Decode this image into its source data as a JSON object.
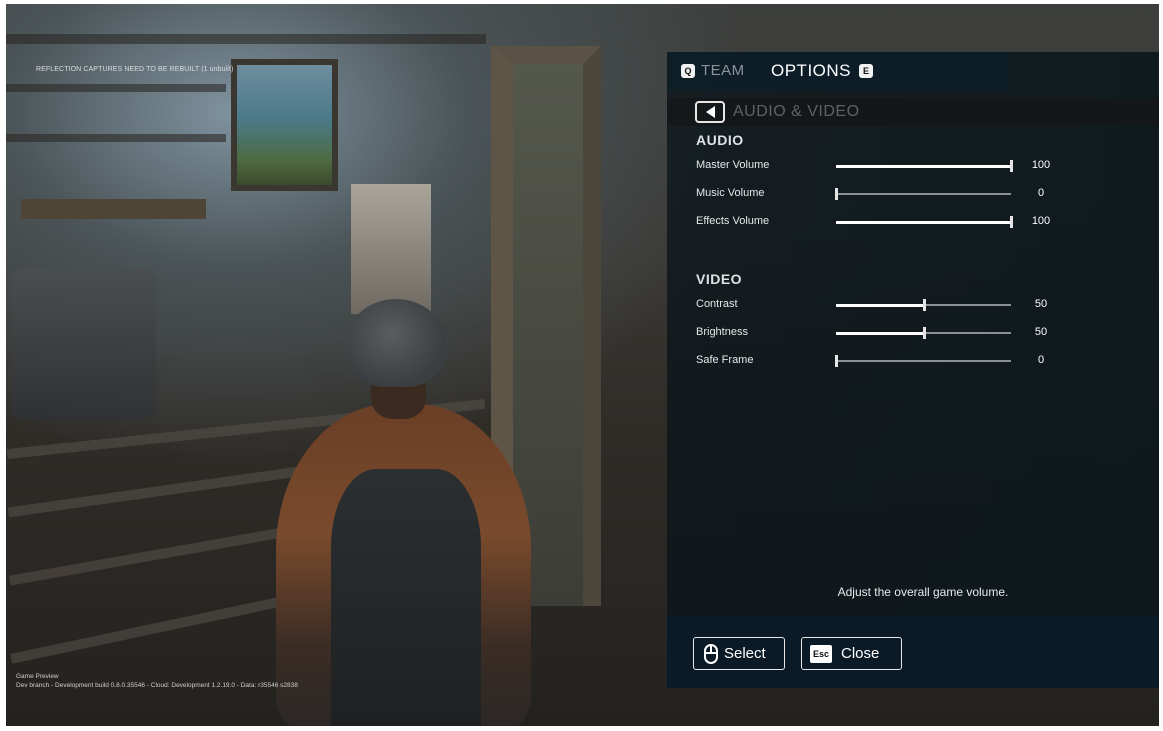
{
  "debug": {
    "top_warning": "REFLECTION CAPTURES NEED TO BE REBUILT (1 unbuilt)",
    "bottom_line1": "Game Preview",
    "bottom_line2": "Dev branch - Development build 0.8.0.35546 - Cloud: Development 1.2.19.0 - Data: r35546 s2838"
  },
  "tabs": {
    "team": {
      "key": "Q",
      "label": "TEAM"
    },
    "options": {
      "label": "OPTIONS",
      "key": "E"
    }
  },
  "subheader": {
    "title": "AUDIO & VIDEO"
  },
  "audio": {
    "title": "AUDIO",
    "settings": [
      {
        "label": "Master Volume",
        "value": "100",
        "level": 1.0
      },
      {
        "label": "Music Volume",
        "value": "0",
        "level": 0.0
      },
      {
        "label": "Effects Volume",
        "value": "100",
        "level": 1.0
      }
    ]
  },
  "video": {
    "title": "VIDEO",
    "settings": [
      {
        "label": "Contrast",
        "value": "50",
        "level": 0.5
      },
      {
        "label": "Brightness",
        "value": "50",
        "level": 0.5
      },
      {
        "label": "Safe Frame",
        "value": "0",
        "level": 0.0
      }
    ]
  },
  "help_text": "Adjust the overall game volume.",
  "footer": {
    "select_label": "Select",
    "esc_key": "Esc",
    "close_label": "Close"
  }
}
